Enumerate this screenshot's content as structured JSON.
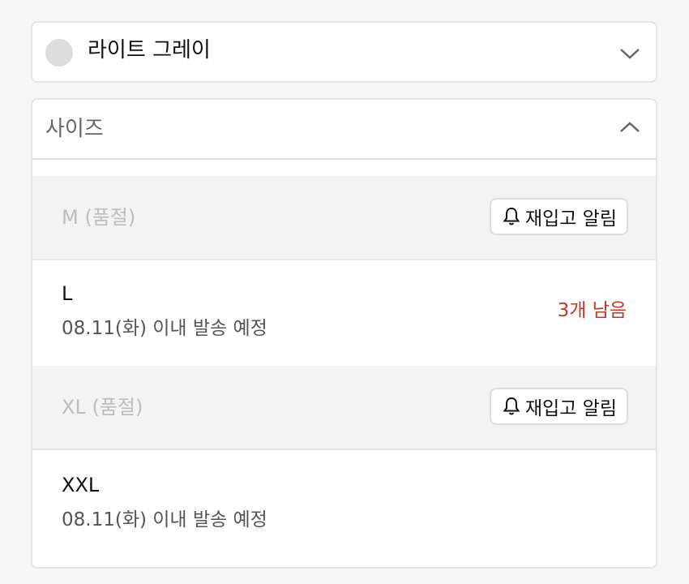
{
  "color_select": {
    "selected": "라이트 그레이",
    "swatch_color": "#dddddd"
  },
  "size_select": {
    "label": "사이즈"
  },
  "options": [
    {
      "name": "M (품절)",
      "button": "재입고 알림"
    },
    {
      "name": "L",
      "shipping": "08.11(화) 이내 발송 예정",
      "stock": "3개 남음"
    },
    {
      "name": "XL (품절)",
      "button": "재입고 알림"
    },
    {
      "name": "XXL",
      "shipping": "08.11(화) 이내 발송 예정"
    }
  ],
  "colors": {
    "stock_warning": "#c0392b",
    "soldout_bg": "#f3f3f3"
  }
}
